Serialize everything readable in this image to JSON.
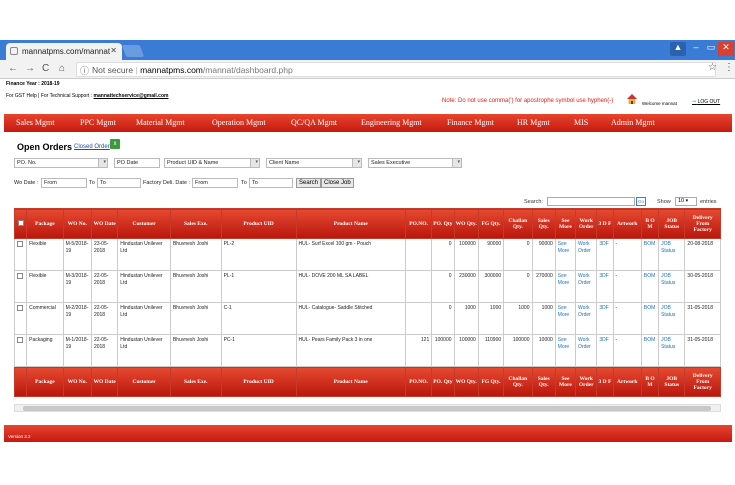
{
  "browser": {
    "tab_title": "mannatpms.com/mannat",
    "url_prefix": "Not secure",
    "url_domain": "mannatpms.com",
    "url_path": "/mannat/dashboard.php",
    "user_badge": "▲",
    "minimize": "–",
    "maximize": "▭",
    "close": "✕"
  },
  "header": {
    "finance_year": "Finance Year : 2018-19",
    "help_prefix": "For GST Help | For Technical Support :",
    "support_email": "mannattechservice@gmail.com",
    "note": "Note: Do not use comma(') for apostrophe symbol use hyphen(-)",
    "welcome": "Welcome mannat",
    "logout": "LOG OUT"
  },
  "nav": {
    "items": [
      "Sales Mgmt",
      "PPC Mgmt",
      "Material Mgmt",
      "Operation Mgmt",
      "QC/QA Mgmt",
      "Engineering Mgmt",
      "Finance Mgmt",
      "HR Mgmt",
      "MIS",
      "Admin Mgmt"
    ]
  },
  "orders": {
    "title": "Open Orders",
    "closed_link": "Closed Order",
    "filters": {
      "po_no": "PO. No.",
      "po_date": "PO Date",
      "product_uid": "Product UID & Name",
      "client_name": "Client Name",
      "sales_exec": "Sales Executive",
      "wo_date": "Wo Date :",
      "from": "From",
      "to": "To",
      "factory_date": "Factory Deli. Date :",
      "search_btn": "Search",
      "close_job_btn": "Close Job"
    },
    "search_label": "Search:",
    "go": "Go",
    "show_label": "Show",
    "show_value": "10",
    "entries_label": "entries"
  },
  "table": {
    "headers": [
      "",
      "Package",
      "WO No.",
      "WO Date",
      "Customer",
      "Sales Exe.",
      "Product UID",
      "Product Name",
      "PO.NO.",
      "PO. Qty",
      "WO Qty.",
      "FG Qty.",
      "Challan Qty.",
      "Sales Qty.",
      "See More",
      "Work Order",
      "3 D F",
      "Artwork",
      "B O M",
      "JOB Status",
      "Delivery From Factory"
    ],
    "rows": [
      [
        "",
        "Flexible",
        "M-5/2018-19",
        "23-05-2018",
        "Hindustan Unilever Ltd",
        "Bhuvnesh Joshi",
        "PL-2",
        "HUL- Surf Excel 100 gm - Pouch",
        "",
        "0",
        "100000",
        "90000",
        "0",
        "90000",
        "See More",
        "Work Order",
        "3DF",
        "-",
        "BOM",
        "JOB Status",
        "20-08-2018"
      ],
      [
        "",
        "Flexible",
        "M-3/2018-19",
        "22-05-2018",
        "Hindustan Unilever Ltd",
        "Bhuvnesh Joshi",
        "PL-1",
        "HUL- DOVE 200 ML SA LABEL",
        "",
        "0",
        "230000",
        "300000",
        "0",
        "270000",
        "See More",
        "Work Order",
        "3DF",
        "-",
        "BOM",
        "JOB Status",
        "30-05-2018"
      ],
      [
        "",
        "Commercial",
        "M-2/2018-19",
        "22-05-2018",
        "Hindustan Unilever Ltd",
        "Bhuvnesh Joshi",
        "C-1",
        "HUL- Catalogue- Saddle Stitched",
        "",
        "0",
        "1000",
        "1000",
        "1000",
        "1000",
        "See More",
        "Work Order",
        "3DF",
        "-",
        "BOM",
        "JOB Status",
        "31-05-2018"
      ],
      [
        "",
        "Packaging",
        "M-1/2018-19",
        "22-05-2018",
        "Hindustan Unilever Ltd",
        "Bhuvnesh Joshi",
        "PC-1",
        "HUL- Pears Family Pack 3 in one",
        "121",
        "100000",
        "100000",
        "110900",
        "100000",
        "10000",
        "See More",
        "Work Order",
        "3DF",
        "-",
        "BOM",
        "JOB Status",
        "31-05-2018"
      ]
    ]
  },
  "footer": {
    "version": "Version 3.2"
  },
  "icons": {
    "back": "back-arrow-icon",
    "forward": "forward-arrow-icon",
    "reload": "reload-icon",
    "home": "home-icon",
    "info": "info-icon",
    "star": "star-icon",
    "menu": "kebab-menu-icon"
  },
  "colors": {
    "nav_red": "#d42e1c",
    "browser_blue": "#3a7bd5",
    "note_red": "#e0201c",
    "link_blue": "#1a6fc0"
  }
}
